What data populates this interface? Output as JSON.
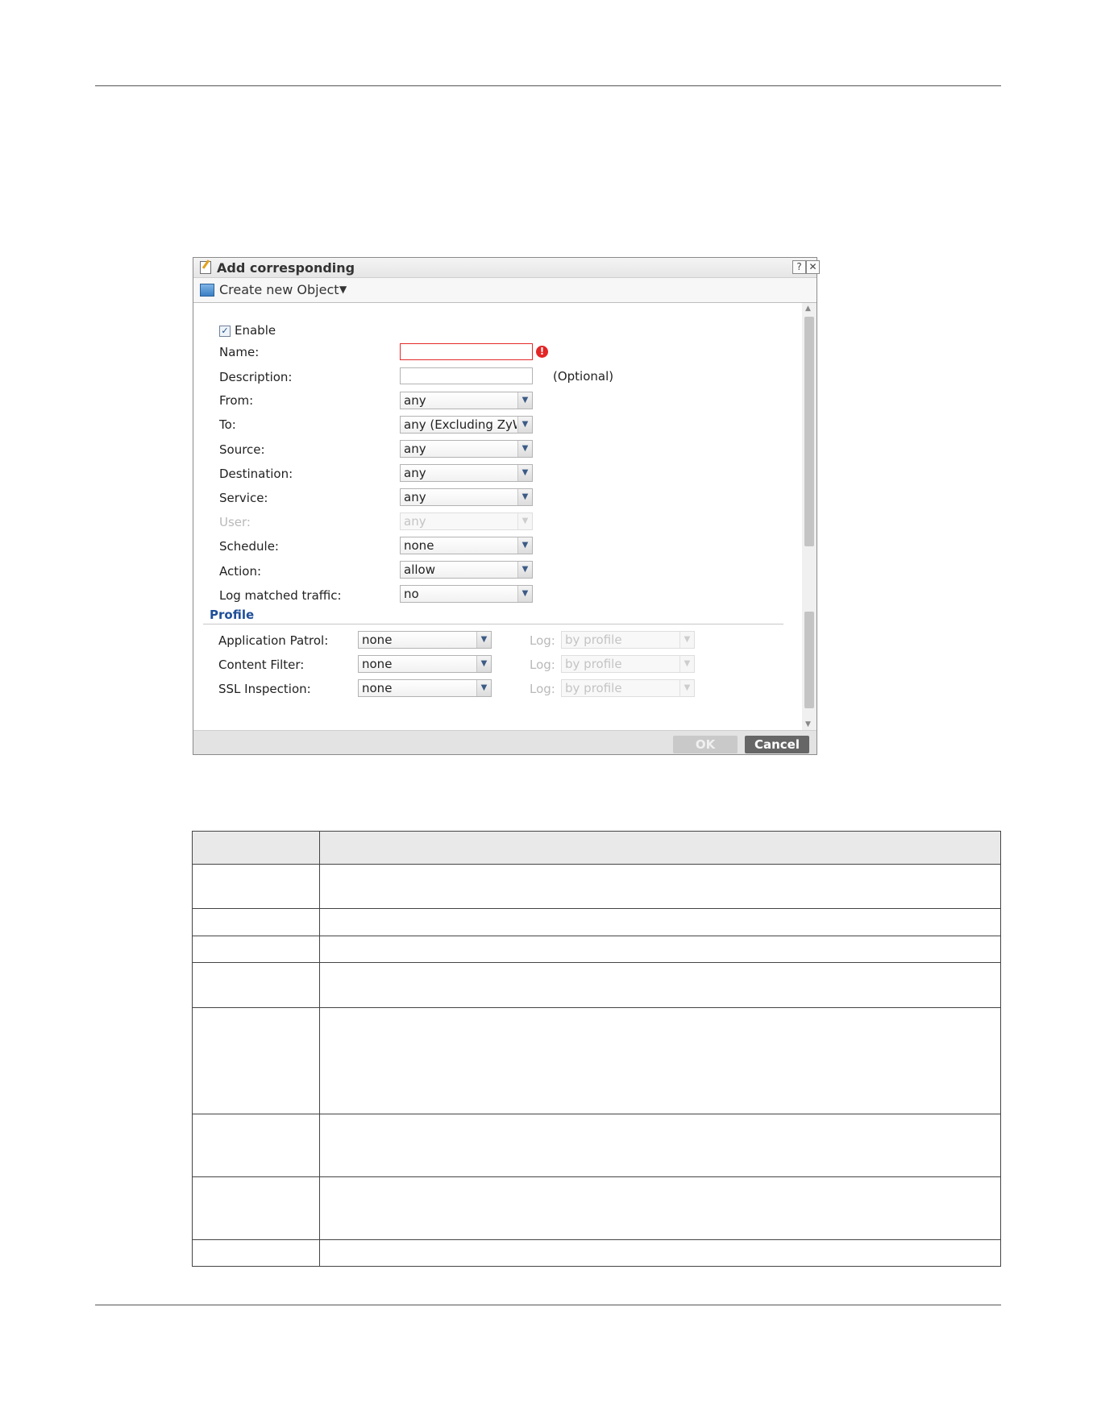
{
  "dialog": {
    "title": "Add corresponding",
    "help_symbol": "?",
    "close_symbol": "✕",
    "toolbar_label": "Create new Object",
    "toolbar_caret": "▼",
    "ok_label": "OK",
    "cancel_label": "Cancel"
  },
  "form": {
    "enable_label": "Enable",
    "enable_checked": true,
    "name_label": "Name:",
    "name_value": "",
    "description_label": "Description:",
    "description_value": "",
    "optional_hint": "(Optional)",
    "from_label": "From:",
    "from_value": "any",
    "to_label": "To:",
    "to_value": "any (Excluding ZyW",
    "source_label": "Source:",
    "source_value": "any",
    "destination_label": "Destination:",
    "destination_value": "any",
    "service_label": "Service:",
    "service_value": "any",
    "user_label": "User:",
    "user_value": "any",
    "schedule_label": "Schedule:",
    "schedule_value": "none",
    "action_label": "Action:",
    "action_value": "allow",
    "log_label": "Log matched traffic:",
    "log_value": "no"
  },
  "profile": {
    "heading": "Profile",
    "log_label": "Log:",
    "rows": [
      {
        "label": "Application Patrol:",
        "value": "none",
        "log_value": "by profile"
      },
      {
        "label": "Content Filter:",
        "value": "none",
        "log_value": "by profile"
      },
      {
        "label": "SSL Inspection:",
        "value": "none",
        "log_value": "by profile"
      }
    ]
  },
  "icons": {
    "title": "edit-icon",
    "toolbar": "object-icon",
    "error": "error-icon",
    "dropdown": "chevron-down-icon",
    "checkbox": "check-icon"
  },
  "colors": {
    "profile_heading": "#1f4f99",
    "error": "#e42525",
    "cancel_bg": "#666666"
  }
}
